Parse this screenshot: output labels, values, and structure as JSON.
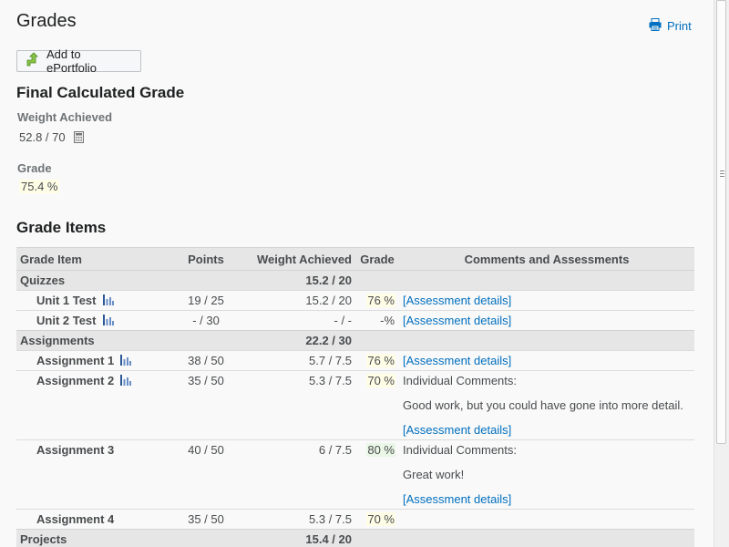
{
  "page": {
    "title": "Grades",
    "print_label": "Print",
    "eportfolio_label": "Add to ePortfolio"
  },
  "final_grade": {
    "heading": "Final Calculated Grade",
    "weight_label": "Weight Achieved",
    "weight_value": "52.8 / 70",
    "grade_label": "Grade",
    "grade_value": "75.4 %"
  },
  "grade_items": {
    "heading": "Grade Items",
    "columns": {
      "item": "Grade Item",
      "points": "Points",
      "weight": "Weight Achieved",
      "grade": "Grade",
      "comments": "Comments and Assessments"
    },
    "rows": [
      {
        "type": "category",
        "name": "Quizzes",
        "weight": "15.2 / 20"
      },
      {
        "type": "item",
        "name": "Unit 1 Test",
        "stats": true,
        "points": "19 / 25",
        "weight": "15.2 / 20",
        "grade": "76 %",
        "grade_color": "yellow",
        "comment_heading": "",
        "comment_text": "",
        "link": "[Assessment details]"
      },
      {
        "type": "item",
        "name": "Unit 2 Test",
        "stats": true,
        "points": "- / 30",
        "weight": "- / -",
        "grade": "-%",
        "grade_color": "none",
        "comment_heading": "",
        "comment_text": "",
        "link": "[Assessment details]"
      },
      {
        "type": "category",
        "name": "Assignments",
        "weight": "22.2 / 30"
      },
      {
        "type": "item",
        "name": "Assignment 1",
        "stats": true,
        "points": "38 / 50",
        "weight": "5.7 / 7.5",
        "grade": "76 %",
        "grade_color": "yellow",
        "comment_heading": "",
        "comment_text": "",
        "link": "[Assessment details]"
      },
      {
        "type": "item",
        "name": "Assignment 2",
        "stats": true,
        "points": "35 / 50",
        "weight": "5.3 / 7.5",
        "grade": "70 %",
        "grade_color": "yellow",
        "comment_heading": "Individual Comments:",
        "comment_text": "Good work, but you could have gone into more detail.",
        "link": "[Assessment details]"
      },
      {
        "type": "item",
        "name": "Assignment 3",
        "stats": false,
        "points": "40 / 50",
        "weight": "6 / 7.5",
        "grade": "80 %",
        "grade_color": "green",
        "comment_heading": "Individual Comments:",
        "comment_text": "Great work!",
        "link": "[Assessment details]"
      },
      {
        "type": "item",
        "name": "Assignment 4",
        "stats": false,
        "points": "35 / 50",
        "weight": "5.3 / 7.5",
        "grade": "70 %",
        "grade_color": "yellow",
        "comment_heading": "",
        "comment_text": "",
        "link": ""
      },
      {
        "type": "category",
        "name": "Projects",
        "weight": "15.4 / 20"
      }
    ]
  },
  "colors": {
    "link": "#006fbf",
    "grade_yellow": "#fffde6",
    "grade_green": "#eaf7e6",
    "header_bg": "#e6e6e6"
  },
  "icons": {
    "print": "printer-icon",
    "eportfolio": "upload-arrow-icon",
    "calculator": "calculator-icon",
    "stats": "bar-chart-icon"
  }
}
